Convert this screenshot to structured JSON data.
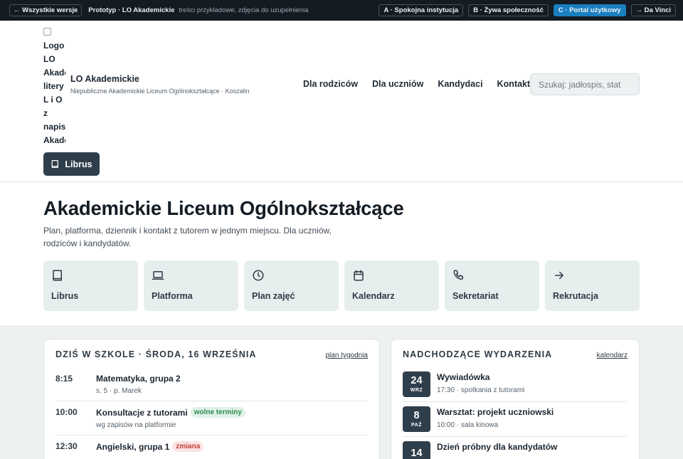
{
  "topbar": {
    "back_label": "← Wszystkie wersje",
    "title": "Prototyp · LO Akademickie",
    "note": "treści przykładowe, zdjęcia do uzupełnienia",
    "variants": [
      {
        "label": "A · Spokojna instytucja",
        "active": false
      },
      {
        "label": "B · Żywa społeczność",
        "active": false
      },
      {
        "label": "C · Portal użytkowy",
        "active": true
      },
      {
        "label": "→ Da Vinci",
        "active": false
      }
    ]
  },
  "header": {
    "logo_alt": "Logo LO Akademickie litery L i O z napisem Akademickie",
    "brand_name": "LO Akademickie",
    "brand_sub": "Niepubliczne Akademickie Liceum Ogólnokształcące · Koszalin",
    "nav": [
      "Dla rodziców",
      "Dla uczniów",
      "Kandydaci",
      "Kontakt"
    ],
    "search_placeholder": "Szukaj: jadłospis, stat",
    "librus_label": "Librus"
  },
  "hero": {
    "title": "Akademickie Liceum Ogólnokształcące",
    "subtitle": "Plan, platforma, dziennik i kontakt z tutorem w jednym miejscu. Dla uczniów, rodziców i kandydatów."
  },
  "tiles": [
    {
      "label": "Librus",
      "icon": "book-icon"
    },
    {
      "label": "Platforma",
      "icon": "laptop-icon"
    },
    {
      "label": "Plan zajęć",
      "icon": "clock-icon"
    },
    {
      "label": "Kalendarz",
      "icon": "calendar-icon"
    },
    {
      "label": "Sekretariat",
      "icon": "phone-icon"
    },
    {
      "label": "Rekrutacja",
      "icon": "arrow-right-icon"
    }
  ],
  "today": {
    "title": "DZIŚ W SZKOLE · ŚRODA, 16 WRZEŚNIA",
    "link": "plan tygodnia",
    "items": [
      {
        "time": "8:15",
        "title": "Matematyka, grupa 2",
        "badge": "",
        "sub": "s. 5 · p. Marek"
      },
      {
        "time": "10:00",
        "title": "Konsultacje z tutorami",
        "badge": "wolne terminy",
        "sub": "wg zapisów na platformie"
      },
      {
        "time": "12:30",
        "title": "Angielski, grupa 1",
        "badge": "zmiana",
        "sub": ""
      }
    ]
  },
  "events": {
    "title": "NADCHODZĄCE WYDARZENIA",
    "link": "kalendarz",
    "items": [
      {
        "day": "24",
        "month": "WRZ",
        "title": "Wywiadówka",
        "sub": "17:30 · spotkania z tutorami"
      },
      {
        "day": "8",
        "month": "PAŹ",
        "title": "Warsztat: projekt uczniowski",
        "sub": "10:00 · sala kinowa"
      },
      {
        "day": "14",
        "month": "",
        "title": "Dzień próbny dla kandydatów",
        "sub": ""
      }
    ]
  },
  "colors": {
    "topbar_bg": "#141b22",
    "accent": "#1a7fc1",
    "dark_button": "#2f3e4b",
    "tile_bg": "#e7eeee"
  }
}
